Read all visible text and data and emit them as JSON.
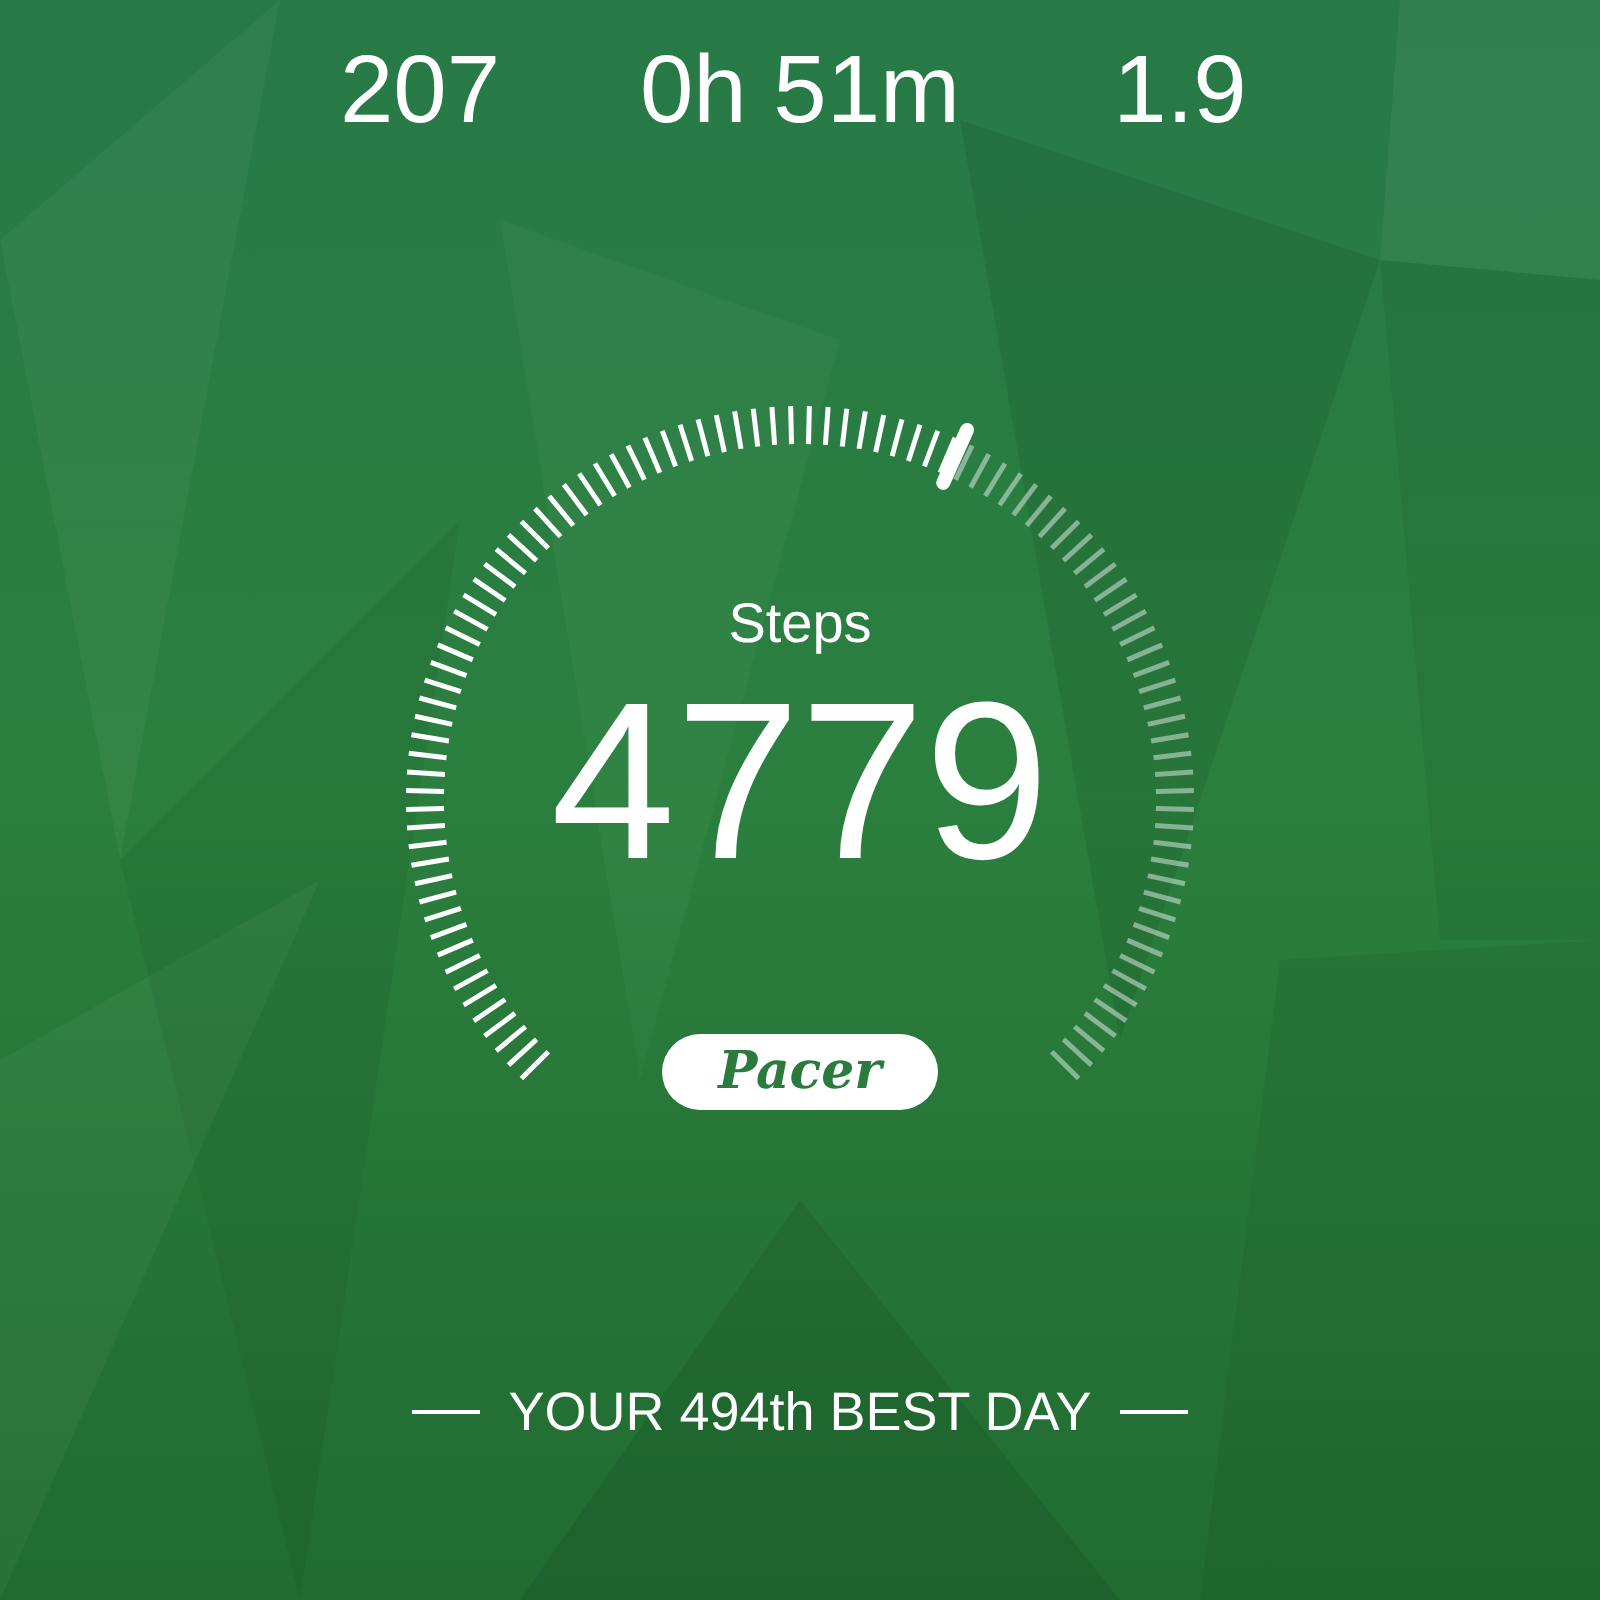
{
  "stats": [
    {
      "value": "207"
    },
    {
      "value": "0h 51m"
    },
    {
      "value": "1.9"
    }
  ],
  "gauge": {
    "label": "Steps",
    "value": "4779"
  },
  "logo": "Pacer",
  "footer": "YOUR 494th BEST DAY"
}
